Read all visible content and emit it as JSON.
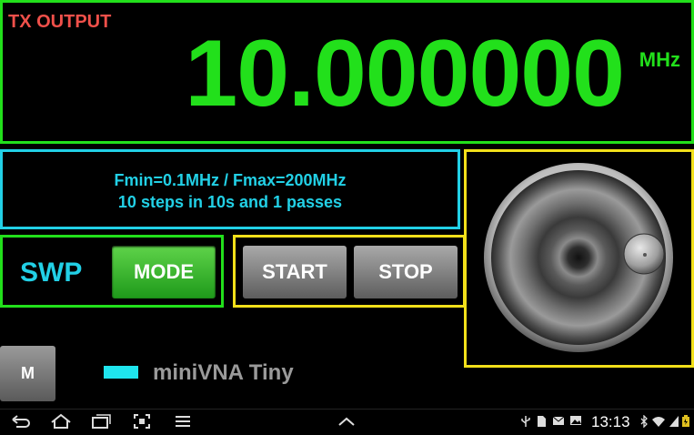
{
  "frequency_display": {
    "label": "TX OUTPUT",
    "value": "10.000000",
    "unit": "MHz"
  },
  "sweep_info": {
    "line1": "Fmin=0.1MHz / Fmax=200MHz",
    "line2": "10 steps in 10s and 1 passes"
  },
  "mode_panel": {
    "mode_label": "SWP",
    "mode_button": "MODE"
  },
  "controls": {
    "start_button": "START",
    "stop_button": "STOP"
  },
  "bottom": {
    "m_button": "M",
    "device_name": "miniVNA Tiny"
  },
  "status_bar": {
    "time": "13:13"
  },
  "colors": {
    "green": "#22e01b",
    "cyan": "#22d0e6",
    "yellow": "#f2e01a",
    "red_label": "#f0504a"
  },
  "icons": [
    "back-icon",
    "home-icon",
    "recent-apps-icon",
    "screenshot-icon",
    "menu-icon",
    "expand-up-icon",
    "usb-icon",
    "sd-card-icon",
    "email-icon",
    "image-icon",
    "bluetooth-icon",
    "wifi-icon",
    "signal-icon",
    "battery-icon"
  ]
}
